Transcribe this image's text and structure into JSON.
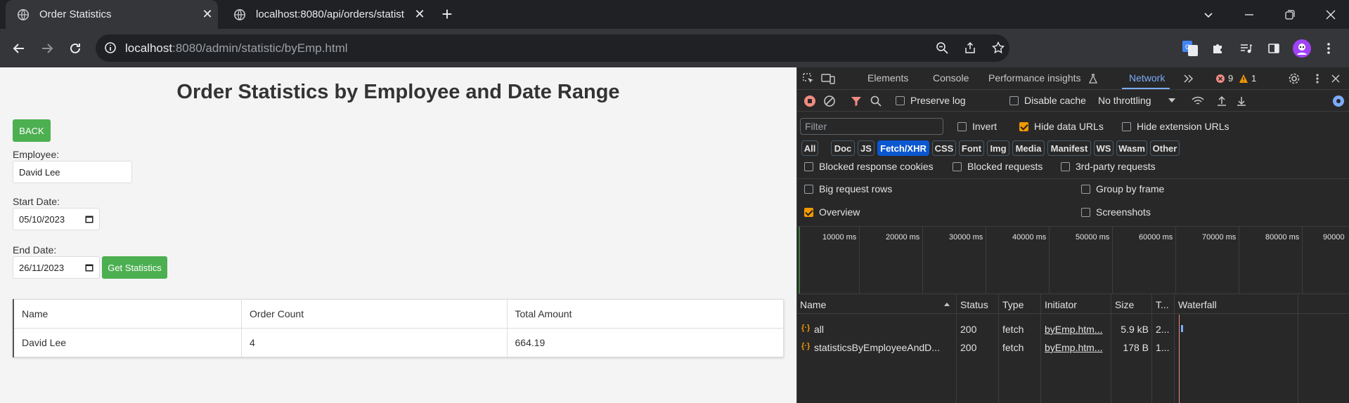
{
  "browser": {
    "tabs": [
      {
        "title": "Order Statistics",
        "active": true
      },
      {
        "title": "localhost:8080/api/orders/statist",
        "active": false
      }
    ],
    "url_host": "localhost",
    "url_rest": ":8080/admin/statistic/byEmp.html"
  },
  "page": {
    "title": "Order Statistics by Employee and Date Range",
    "back_label": "BACK",
    "employee_label": "Employee:",
    "employee_value": "David Lee",
    "start_label": "Start Date:",
    "start_value": "05/10/2023",
    "end_label": "End Date:",
    "end_value": "26/11/2023",
    "get_label": "Get Statistics",
    "table": {
      "headers": [
        "Name",
        "Order Count",
        "Total Amount"
      ],
      "rows": [
        [
          "David Lee",
          "4",
          "664.19"
        ]
      ]
    }
  },
  "devtools": {
    "tabs": [
      "Elements",
      "Console",
      "Performance insights",
      "Network"
    ],
    "active_tab": "Network",
    "error_count": "9",
    "warning_count": "1",
    "preserve_log": "Preserve log",
    "disable_cache": "Disable cache",
    "throttling": "No throttling",
    "filter_placeholder": "Filter",
    "invert": "Invert",
    "hide_data_urls": "Hide data URLs",
    "hide_extension_urls": "Hide extension URLs",
    "types": [
      "All",
      "Doc",
      "JS",
      "Fetch/XHR",
      "CSS",
      "Font",
      "Img",
      "Media",
      "Manifest",
      "WS",
      "Wasm",
      "Other"
    ],
    "selected_type": "Fetch/XHR",
    "blocked_response_cookies": "Blocked response cookies",
    "blocked_requests": "Blocked requests",
    "third_party": "3rd-party requests",
    "big_request_rows": "Big request rows",
    "group_by_frame": "Group by frame",
    "overview": "Overview",
    "screenshots": "Screenshots",
    "timeline_ticks": [
      "10000 ms",
      "20000 ms",
      "30000 ms",
      "40000 ms",
      "50000 ms",
      "60000 ms",
      "70000 ms",
      "80000 ms",
      "90000"
    ],
    "columns": [
      "Name",
      "Status",
      "Type",
      "Initiator",
      "Size",
      "T...",
      "Waterfall"
    ],
    "requests": [
      {
        "name": "all",
        "status": "200",
        "type": "fetch",
        "initiator": "byEmp.htm...",
        "size": "5.9 kB",
        "time": "2..."
      },
      {
        "name": "statisticsByEmployeeAndD...",
        "status": "200",
        "type": "fetch",
        "initiator": "byEmp.htm...",
        "size": "178 B",
        "time": "1..."
      }
    ]
  },
  "colors": {
    "accent_green": "#4caf50",
    "devtools_blue": "#7cacf8",
    "warning_orange": "#f29900",
    "error_red": "#f28b82"
  }
}
